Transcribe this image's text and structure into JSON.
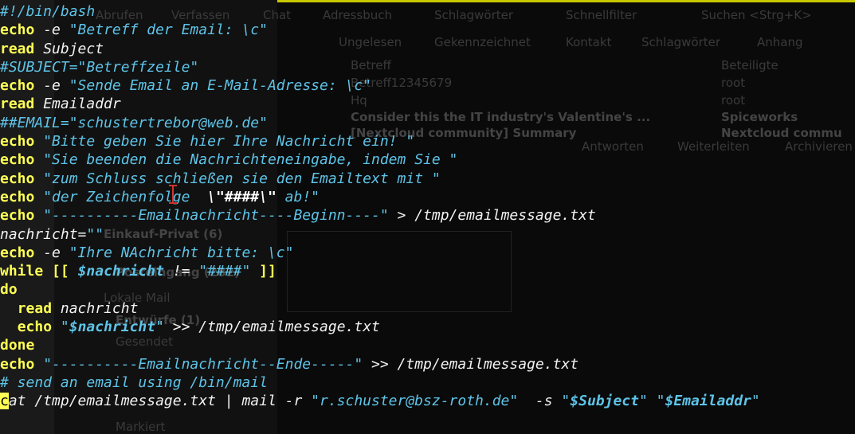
{
  "background_app": {
    "toolbar": [
      "Abrufen",
      "Verfassen",
      "Chat",
      "Adressbuch",
      "Schlagwörter",
      "Schnellfilter",
      "Suchen <Strg+K>"
    ],
    "filter_bar": [
      "Ungelesen",
      "Gekennzeichnet",
      "Kontakt",
      "Schlagwörter",
      "Anhang"
    ],
    "columns": [
      "Betreff",
      "Beteiligte"
    ],
    "messages": [
      {
        "subject": "Betreff12345679",
        "from": "root"
      },
      {
        "subject": "Hq",
        "from": "root"
      },
      {
        "subject": "Consider this the IT industry's Valentine's ...",
        "from": "Spiceworks"
      },
      {
        "subject": "[Nextcloud community] Summary",
        "from": "Nextcloud commu"
      }
    ],
    "actions": [
      "Antworten",
      "Weiterleiten",
      "Archivieren"
    ],
    "folders": [
      "Einkauf-Privat (6)",
      "Posteingang (282)",
      "Lokale Mail",
      "Entwürfe (1)",
      "Gesendet",
      "Markiert"
    ]
  },
  "terminal": {
    "lines": [
      [
        {
          "c": "cm",
          "t": "#!/bin/bash"
        }
      ],
      [
        {
          "c": "kw",
          "t": "echo"
        },
        {
          "c": "plain",
          "t": " -e "
        },
        {
          "c": "str",
          "t": "\"Betreff der Email: \\c\""
        }
      ],
      [
        {
          "c": "kw",
          "t": "read"
        },
        {
          "c": "plain",
          "t": " Subject"
        }
      ],
      [
        {
          "c": "cm",
          "t": "#SUBJECT=\"Betreffzeile\""
        }
      ],
      [
        {
          "c": "kw",
          "t": "echo"
        },
        {
          "c": "plain",
          "t": " -e "
        },
        {
          "c": "str",
          "t": "\"Sende Email an E-Mail-Adresse: \\c\""
        }
      ],
      [
        {
          "c": "kw",
          "t": "read"
        },
        {
          "c": "plain",
          "t": " Emailaddr"
        }
      ],
      [
        {
          "c": "cm",
          "t": "##EMAIL=\"schustertrebor@web.de\""
        }
      ],
      [
        {
          "c": "kw",
          "t": "echo"
        },
        {
          "c": "plain",
          "t": " "
        },
        {
          "c": "str",
          "t": "\"Bitte geben Sie hier Ihre Nachricht ein! \""
        }
      ],
      [
        {
          "c": "kw",
          "t": "echo"
        },
        {
          "c": "plain",
          "t": " "
        },
        {
          "c": "str",
          "t": "\"Sie beenden die Nachrichteneingabe, indem Sie \""
        }
      ],
      [
        {
          "c": "kw",
          "t": "echo"
        },
        {
          "c": "plain",
          "t": " "
        },
        {
          "c": "str",
          "t": "\"zum Schluss schließen sie den Emailtext mit \""
        }
      ],
      [
        {
          "c": "kw",
          "t": "echo"
        },
        {
          "c": "plain",
          "t": " "
        },
        {
          "c": "str",
          "t": "\"der Zeichenfolge  "
        },
        {
          "c": "esc",
          "t": "\\\"####\\\""
        },
        {
          "c": "str",
          "t": " ab!\""
        }
      ],
      [
        {
          "c": "kw",
          "t": "echo"
        },
        {
          "c": "plain",
          "t": " "
        },
        {
          "c": "str",
          "t": "\"----------Emailnachricht----Beginn----\""
        },
        {
          "c": "plain",
          "t": " > /tmp/emailmessage.txt"
        }
      ],
      [
        {
          "c": "plain",
          "t": "nachricht="
        },
        {
          "c": "str",
          "t": "\"\""
        }
      ],
      [
        {
          "c": "kw",
          "t": "echo"
        },
        {
          "c": "plain",
          "t": " -e "
        },
        {
          "c": "str",
          "t": "\"Ihre NAchricht bitte: \\c\""
        }
      ],
      [
        {
          "c": "kw",
          "t": "while"
        },
        {
          "c": "plain",
          "t": " "
        },
        {
          "c": "kw",
          "t": "[["
        },
        {
          "c": "plain",
          "t": " "
        },
        {
          "c": "var",
          "t": "$nachricht"
        },
        {
          "c": "plain",
          "t": " != "
        },
        {
          "c": "str",
          "t": "\"####\""
        },
        {
          "c": "plain",
          "t": " "
        },
        {
          "c": "kw",
          "t": "]]"
        }
      ],
      [
        {
          "c": "kw",
          "t": "do"
        }
      ],
      [
        {
          "c": "plain",
          "t": "  "
        },
        {
          "c": "kw",
          "t": "read"
        },
        {
          "c": "plain",
          "t": " nachricht"
        }
      ],
      [
        {
          "c": "plain",
          "t": "  "
        },
        {
          "c": "kw",
          "t": "echo"
        },
        {
          "c": "plain",
          "t": " "
        },
        {
          "c": "str",
          "t": "\""
        },
        {
          "c": "var",
          "t": "$nachricht"
        },
        {
          "c": "str",
          "t": "\""
        },
        {
          "c": "plain",
          "t": " >> /tmp/emailmessage.txt"
        }
      ],
      [
        {
          "c": "kw",
          "t": "done"
        }
      ],
      [
        {
          "c": "kw",
          "t": "echo"
        },
        {
          "c": "plain",
          "t": " "
        },
        {
          "c": "str",
          "t": "\"----------Emailnachricht--Ende-----\""
        },
        {
          "c": "plain",
          "t": " >> /tmp/emailmessage.txt"
        }
      ],
      [
        {
          "c": "cm",
          "t": "# send an email using /bin/mail"
        }
      ],
      [
        {
          "c": "cursor",
          "t": "c"
        },
        {
          "c": "plain",
          "t": "at /tmp/emailmessage.txt | mail -r "
        },
        {
          "c": "str",
          "t": "\"r.schuster@bsz-roth.de\""
        },
        {
          "c": "plain",
          "t": "  -s "
        },
        {
          "c": "str",
          "t": "\""
        },
        {
          "c": "var",
          "t": "$Subject"
        },
        {
          "c": "str",
          "t": "\""
        },
        {
          "c": "plain",
          "t": " "
        },
        {
          "c": "str",
          "t": "\""
        },
        {
          "c": "var",
          "t": "$Emailaddr"
        },
        {
          "c": "str",
          "t": "\""
        }
      ]
    ]
  }
}
